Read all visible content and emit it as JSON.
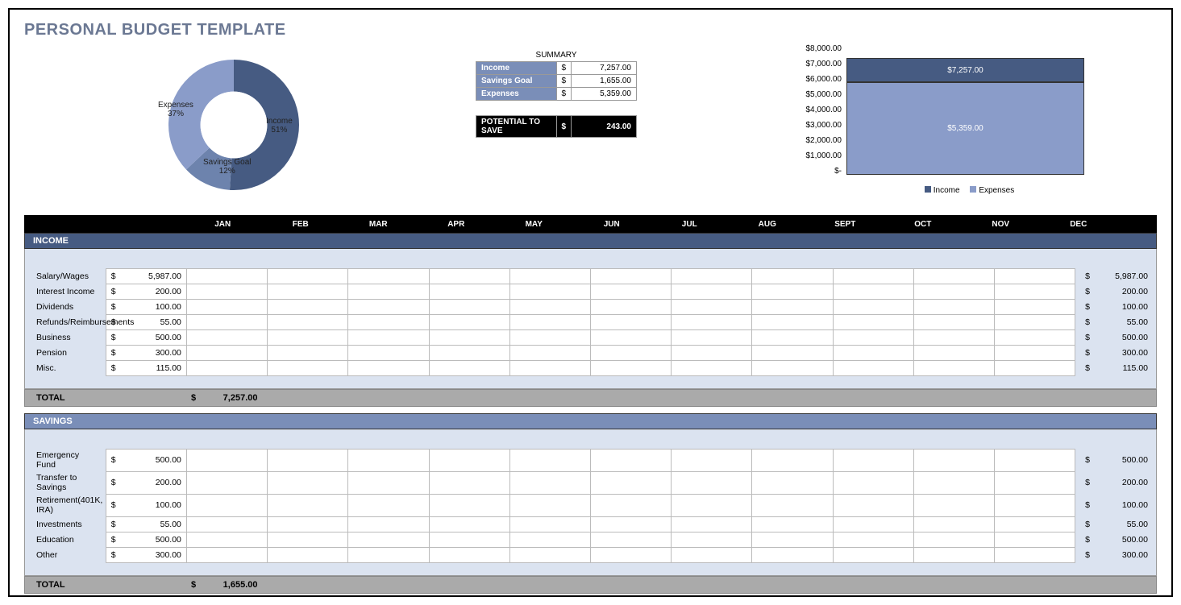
{
  "title": "PERSONAL BUDGET TEMPLATE",
  "summary": {
    "header": "SUMMARY",
    "rows": [
      {
        "label": "Income",
        "dollar": "$",
        "value": "7,257.00"
      },
      {
        "label": "Savings Goal",
        "dollar": "$",
        "value": "1,655.00"
      },
      {
        "label": "Expenses",
        "dollar": "$",
        "value": "5,359.00"
      }
    ],
    "potential_label": "POTENTIAL TO SAVE",
    "potential_dollar": "$",
    "potential_value": "243.00"
  },
  "donut": {
    "income_label": "Income",
    "income_pct": "51%",
    "expenses_label": "Expenses",
    "expenses_pct": "37%",
    "savings_label": "Savings Goal",
    "savings_pct": "12%"
  },
  "bar": {
    "axis": [
      "$8,000.00",
      "$7,000.00",
      "$6,000.00",
      "$5,000.00",
      "$4,000.00",
      "$3,000.00",
      "$2,000.00",
      "$1,000.00",
      "$-"
    ],
    "income_value": "$7,257.00",
    "expenses_value": "$5,359.00",
    "legend_income": "Income",
    "legend_expenses": "Expenses"
  },
  "months": [
    "JAN",
    "FEB",
    "MAR",
    "APR",
    "MAY",
    "JUN",
    "JUL",
    "AUG",
    "SEPT",
    "OCT",
    "NOV",
    "DEC"
  ],
  "sections": [
    {
      "name": "INCOME",
      "rows": [
        {
          "label": "Salary/Wages",
          "jan": "5,987.00",
          "total": "5,987.00"
        },
        {
          "label": "Interest Income",
          "jan": "200.00",
          "total": "200.00"
        },
        {
          "label": "Dividends",
          "jan": "100.00",
          "total": "100.00"
        },
        {
          "label": "Refunds/Reimbursements",
          "jan": "55.00",
          "total": "55.00"
        },
        {
          "label": "Business",
          "jan": "500.00",
          "total": "500.00"
        },
        {
          "label": "Pension",
          "jan": "300.00",
          "total": "300.00"
        },
        {
          "label": "Misc.",
          "jan": "115.00",
          "total": "115.00"
        }
      ],
      "total_label": "TOTAL",
      "total_jan": "7,257.00"
    },
    {
      "name": "SAVINGS",
      "rows": [
        {
          "label": "Emergency Fund",
          "jan": "500.00",
          "total": "500.00"
        },
        {
          "label": "Transfer to Savings",
          "jan": "200.00",
          "total": "200.00"
        },
        {
          "label": "Retirement(401K, IRA)",
          "jan": "100.00",
          "total": "100.00"
        },
        {
          "label": "Investments",
          "jan": "55.00",
          "total": "55.00"
        },
        {
          "label": "Education",
          "jan": "500.00",
          "total": "500.00"
        },
        {
          "label": "Other",
          "jan": "300.00",
          "total": "300.00"
        }
      ],
      "total_label": "TOTAL",
      "total_jan": "1,655.00"
    }
  ],
  "chart_data": [
    {
      "type": "pie",
      "title": "",
      "series": [
        {
          "name": "Income",
          "value": 51,
          "display": "51%"
        },
        {
          "name": "Expenses",
          "value": 37,
          "display": "37%"
        },
        {
          "name": "Savings Goal",
          "value": 12,
          "display": "12%"
        }
      ]
    },
    {
      "type": "bar",
      "categories": [
        ""
      ],
      "series": [
        {
          "name": "Income",
          "values": [
            7257.0
          ]
        },
        {
          "name": "Expenses",
          "values": [
            5359.0
          ]
        }
      ],
      "ylim": [
        0,
        8000
      ],
      "ylabel": "",
      "xlabel": "",
      "legend": [
        "Income",
        "Expenses"
      ]
    }
  ]
}
